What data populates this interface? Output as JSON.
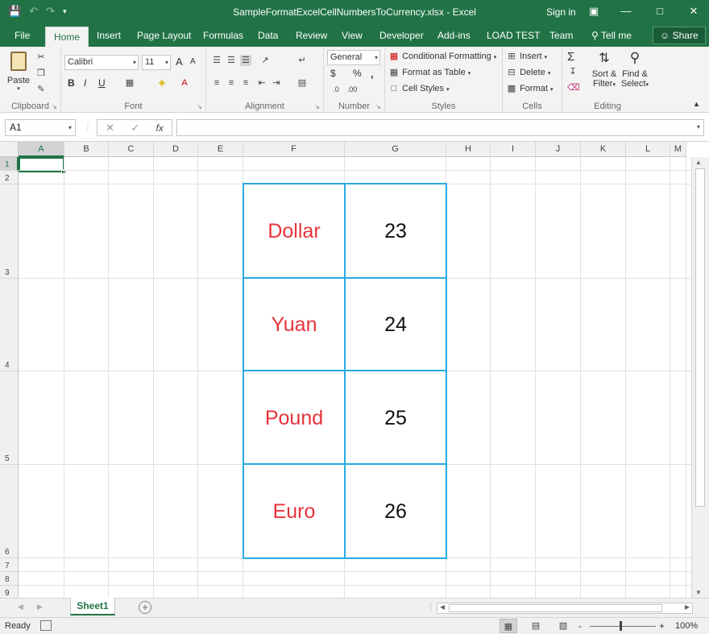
{
  "window": {
    "title": "SampleFormatExcelCellNumbersToCurrency.xlsx - Excel",
    "sign_in": "Sign in",
    "icons": [
      "save-icon",
      "undo-icon",
      "redo-icon",
      "customize-qat-icon",
      "ribbon-display-icon",
      "minimize-icon",
      "restore-icon",
      "close-icon"
    ]
  },
  "tabs": [
    {
      "label": "File"
    },
    {
      "label": "Home"
    },
    {
      "label": "Insert"
    },
    {
      "label": "Page Layout"
    },
    {
      "label": "Formulas"
    },
    {
      "label": "Data"
    },
    {
      "label": "Review"
    },
    {
      "label": "View"
    },
    {
      "label": "Developer"
    },
    {
      "label": "Add-ins"
    },
    {
      "label": "LOAD TEST"
    },
    {
      "label": "Team"
    }
  ],
  "tell_me": "Tell me",
  "share": "Share",
  "ribbon": {
    "clipboard": {
      "label": "Clipboard",
      "paste": "Paste"
    },
    "font": {
      "label": "Font",
      "name": "Calibri",
      "size": "11",
      "bold": "B",
      "italic": "I",
      "underline": "U",
      "grow": "A",
      "shrink": "A"
    },
    "alignment": {
      "label": "Alignment"
    },
    "number": {
      "label": "Number",
      "format": "General",
      "currency": "$",
      "percent": "%",
      "comma": ","
    },
    "styles": {
      "label": "Styles",
      "conditional": "Conditional Formatting",
      "format_table": "Format as Table",
      "cell_styles": "Cell Styles"
    },
    "cells": {
      "label": "Cells",
      "insert": "Insert",
      "delete": "Delete",
      "format": "Format"
    },
    "editing": {
      "label": "Editing",
      "sort_1": "Sort &",
      "sort_2": "Filter",
      "find_1": "Find &",
      "find_2": "Select"
    }
  },
  "formula_bar": {
    "name_box": "A1",
    "fx": "fx",
    "formula": ""
  },
  "columns": [
    "A",
    "B",
    "C",
    "D",
    "E",
    "F",
    "G",
    "H",
    "I",
    "J",
    "K",
    "L",
    "M"
  ],
  "rows": [
    "1",
    "2",
    "3",
    "4",
    "5",
    "6",
    "7",
    "8",
    "9"
  ],
  "cells": [
    {
      "currency": "Dollar",
      "value": "23"
    },
    {
      "currency": "Yuan",
      "value": "24"
    },
    {
      "currency": "Pound",
      "value": "25"
    },
    {
      "currency": "Euro",
      "value": "26"
    }
  ],
  "colors": {
    "accent": "#217346",
    "currency_text": "#e8323a",
    "table_border": "#29aae1"
  },
  "sheet_tabs": [
    {
      "label": "Sheet1"
    }
  ],
  "status": {
    "ready": "Ready",
    "zoom": "100%",
    "zoom_minus": "-",
    "zoom_plus": "+"
  }
}
